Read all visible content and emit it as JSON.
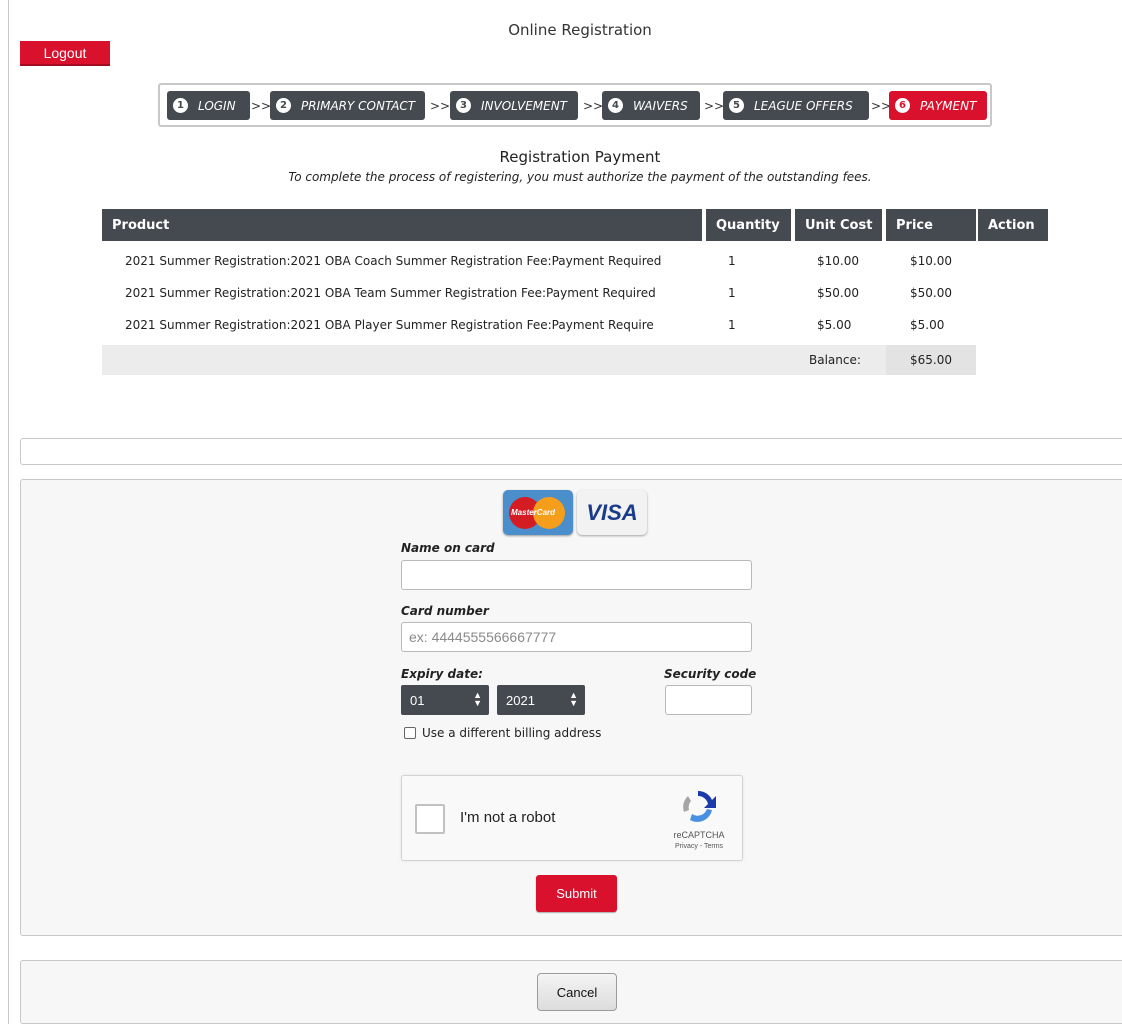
{
  "page": {
    "title": "Online Registration"
  },
  "header": {
    "logout_label": "Logout"
  },
  "steps": [
    {
      "num": "1",
      "label": "LOGIN",
      "active": false
    },
    {
      "num": "2",
      "label": "PRIMARY CONTACT",
      "active": false
    },
    {
      "num": "3",
      "label": "INVOLVEMENT",
      "active": false
    },
    {
      "num": "4",
      "label": "WAIVERS",
      "active": false
    },
    {
      "num": "5",
      "label": "LEAGUE OFFERS",
      "active": false
    },
    {
      "num": "6",
      "label": "PAYMENT",
      "active": true
    }
  ],
  "step_separator": ">>",
  "payment": {
    "title": "Registration Payment",
    "subtitle": "To complete the process of registering, you must authorize the payment of the outstanding fees."
  },
  "table": {
    "headers": [
      "Product",
      "Quantity",
      "Unit Cost",
      "Price",
      "Action"
    ],
    "rows": [
      {
        "product": "2021 Summer Registration:2021 OBA Coach Summer Registration Fee:Payment Required",
        "quantity": "1",
        "unit_cost": "$10.00",
        "price": "$10.00"
      },
      {
        "product": "2021 Summer Registration:2021 OBA Team Summer Registration Fee:Payment Required",
        "quantity": "1",
        "unit_cost": "$50.00",
        "price": "$50.00"
      },
      {
        "product": "2021 Summer Registration:2021 OBA Player Summer Registration Fee:Payment Require",
        "quantity": "1",
        "unit_cost": "$5.00",
        "price": "$5.00"
      }
    ],
    "balance_label": "Balance:",
    "balance_value": "$65.00"
  },
  "cards": {
    "mastercard_label": "MasterCard",
    "visa_label": "VISA"
  },
  "form": {
    "name_label": "Name on card",
    "name_value": "",
    "card_label": "Card number",
    "card_placeholder": "ex: 4444555566667777",
    "expiry_label": "Expiry date:",
    "expiry_month": "01",
    "expiry_year": "2021",
    "security_label": "Security code",
    "billing_label": "Use a different billing address"
  },
  "captcha": {
    "text": "I'm not a robot",
    "brand": "reCAPTCHA",
    "links": "Privacy - Terms"
  },
  "actions": {
    "submit_label": "Submit",
    "cancel_label": "Cancel"
  }
}
